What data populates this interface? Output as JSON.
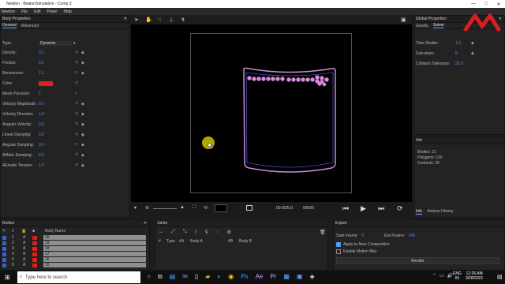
{
  "window": {
    "title": "Newton - BeakerSimulation - Comp 3",
    "controls": [
      "—",
      "□",
      "✕"
    ]
  },
  "menu": [
    "Newton",
    "File",
    "Edit",
    "Panel",
    "Help"
  ],
  "body_properties": {
    "title": "Body Properties",
    "tabs": [
      "General",
      "Advanced"
    ],
    "rows": [
      {
        "label": "Type:",
        "value": "Dynamic"
      },
      {
        "label": "Density:",
        "value": "0.1"
      },
      {
        "label": "Friction:",
        "value": "0.1"
      },
      {
        "label": "Bounciness:",
        "value": "1.1"
      },
      {
        "label": "Color:",
        "value": ""
      },
      {
        "label": "Mesh Precision:",
        "value": "1"
      },
      {
        "label": "Velocity Magnitude:",
        "value": "0.0"
      },
      {
        "label": "Velocity Direction:",
        "value": "1.0"
      },
      {
        "label": "Angular Velocity:",
        "value": "0.0"
      },
      {
        "label": "Linear Damping:",
        "value": "0.0"
      },
      {
        "label": "Angular Damping:",
        "value": "0.0"
      },
      {
        "label": "AMatic Damping:",
        "value": "0.5"
      },
      {
        "label": "AEmatic Tension:",
        "value": "1.0"
      }
    ],
    "color_swatch": "#e0201a"
  },
  "global_properties": {
    "title": "Global Properties",
    "tabs": [
      "Gravity",
      "Solver"
    ],
    "rows": [
      {
        "label": "Time Divider:",
        "value": "1.0"
      },
      {
        "label": "Sub-steps:",
        "value": "8"
      },
      {
        "label": "Collision Tolerance:",
        "value": "25.0"
      }
    ]
  },
  "info": {
    "title": "Info",
    "lines": [
      "Bodies: 21",
      "Polygons: 130",
      "Contacts: 35"
    ],
    "tabs": [
      "Info",
      "Actions History"
    ]
  },
  "timeline": {
    "time": "00.0/25.0",
    "frame": "00000"
  },
  "bodies_panel": {
    "title": "Bodies",
    "headers": [
      "#",
      "Body Name"
    ],
    "rows": [
      {
        "num": "1",
        "name": "20"
      },
      {
        "num": "2",
        "name": "19"
      },
      {
        "num": "3",
        "name": "18"
      },
      {
        "num": "4",
        "name": "17"
      },
      {
        "num": "5",
        "name": "16"
      },
      {
        "num": "6",
        "name": "15"
      }
    ]
  },
  "joints_panel": {
    "title": "Joints",
    "headers": [
      "#",
      "Type",
      "#A",
      "Body A",
      "#B",
      "Body B"
    ]
  },
  "export_panel": {
    "title": "Export",
    "start_frame_label": "Start Frame:",
    "start_frame": "0",
    "end_frame_label": "End Frame:",
    "end_frame": "248",
    "apply_label": "Apply to New Composition",
    "motion_blur_label": "Enable Motion Blur",
    "render_label": "Render"
  },
  "taskbar": {
    "search_placeholder": "Type here to search",
    "lang1": "ENG",
    "lang2": "IN",
    "time": "12:26 AM",
    "date": "3/28/2021"
  },
  "colors": {
    "beaker_outline": "#c98bd8",
    "beaker_inner": "#6b6cff",
    "ball_fill": "#d88bd8",
    "cursor_highlight": "#d4c200",
    "accent_blue": "#4b8ff0"
  }
}
